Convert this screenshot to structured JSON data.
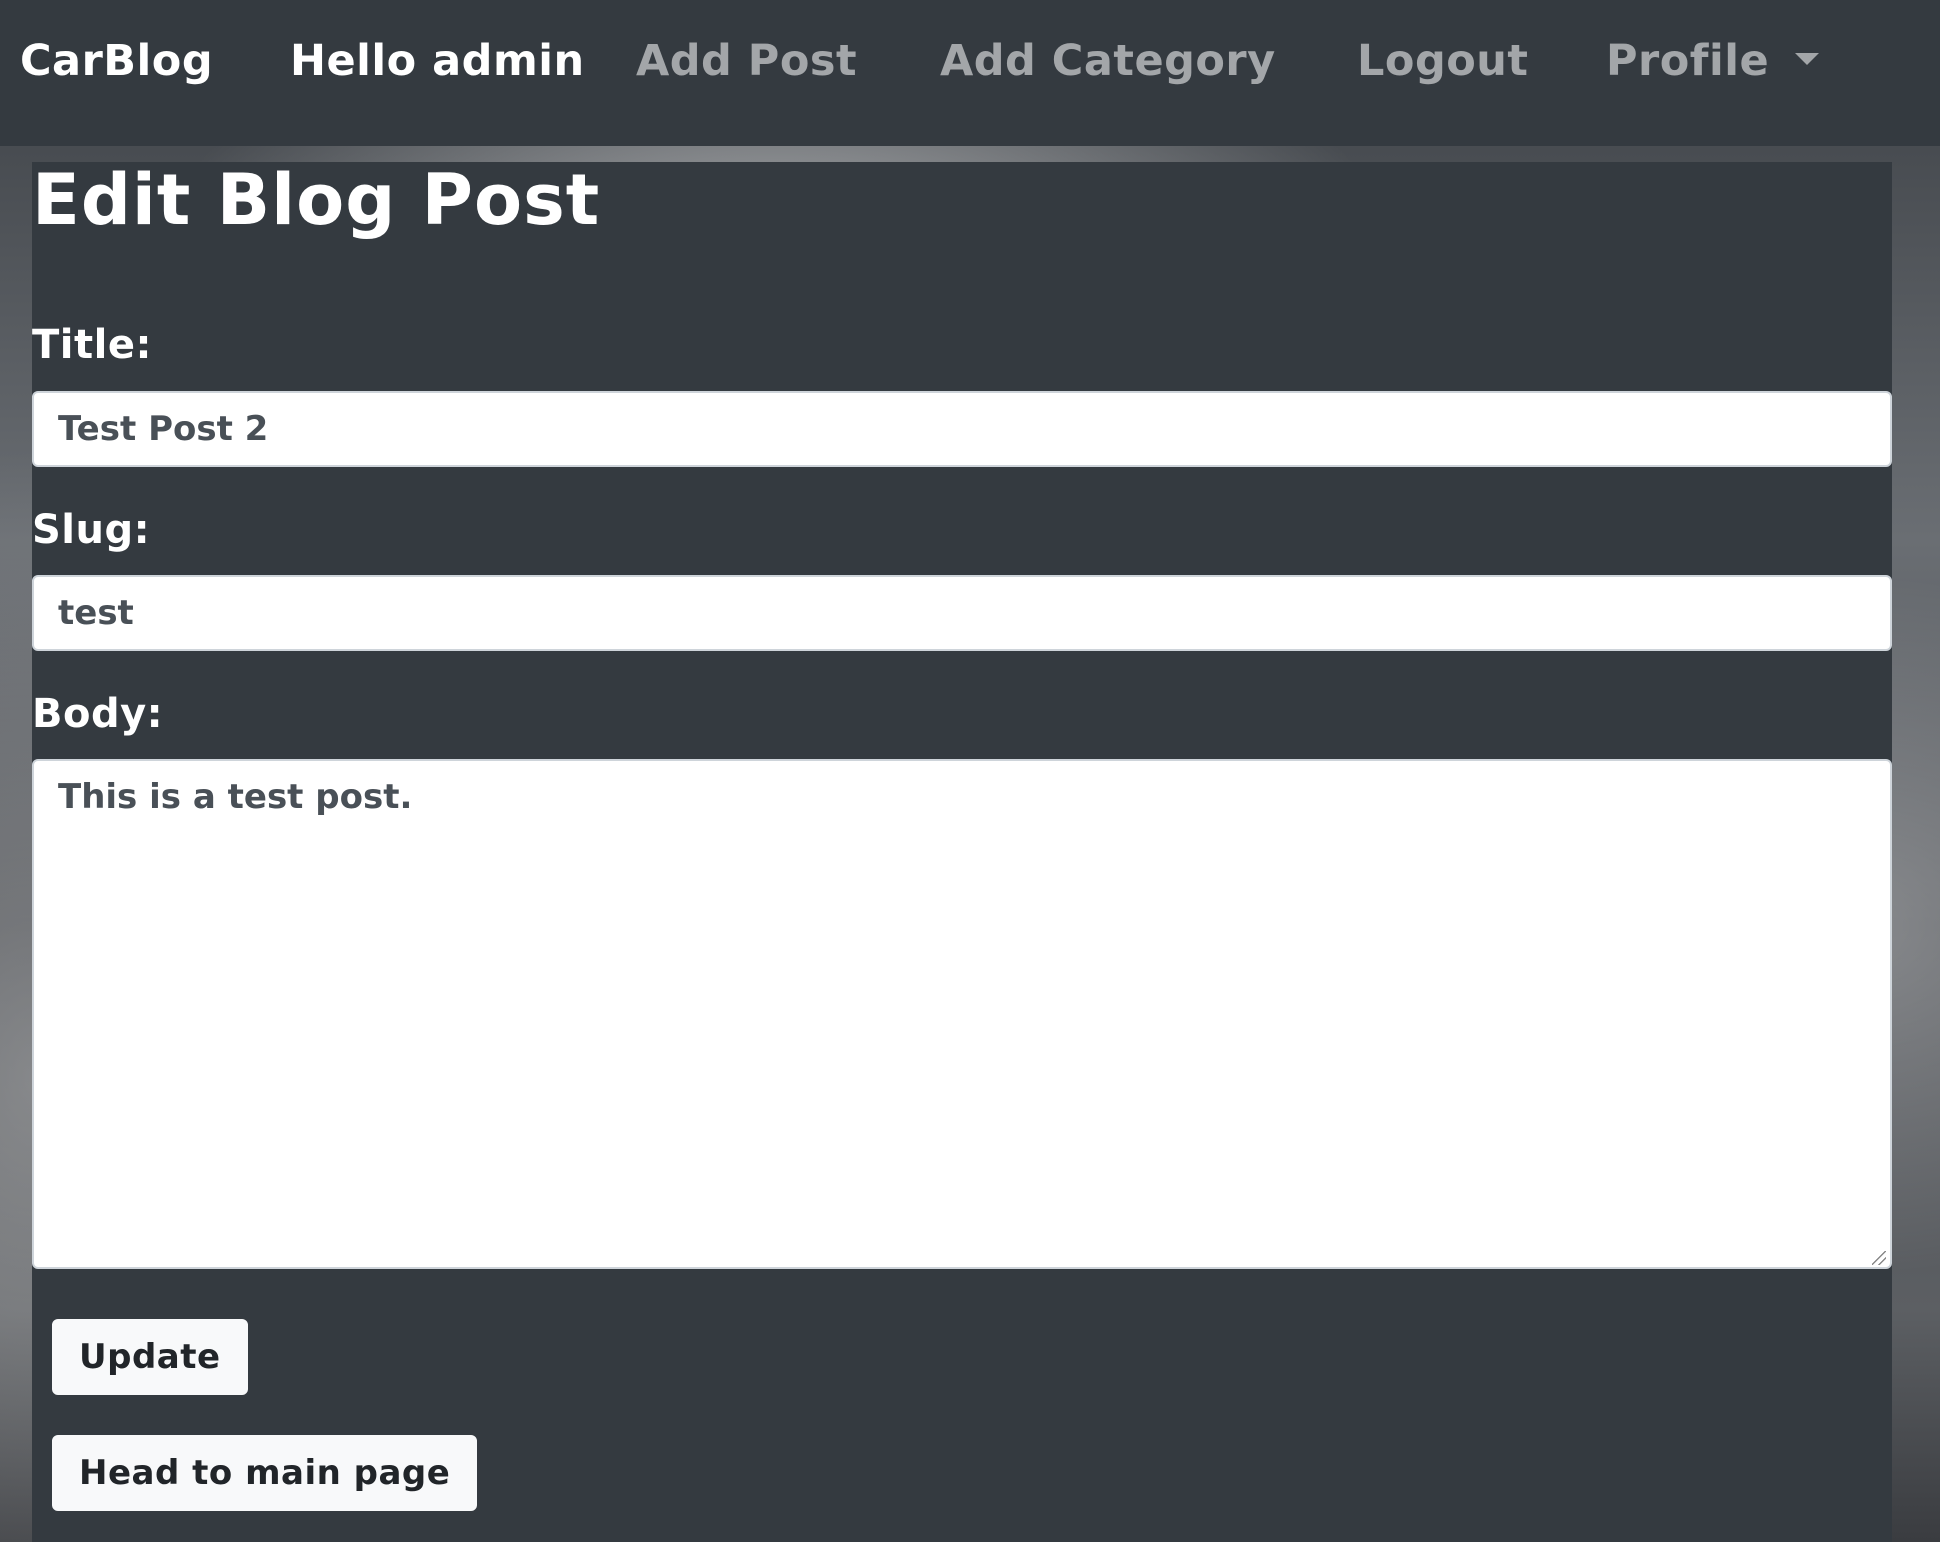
{
  "navbar": {
    "brand": "CarBlog",
    "greeting": "Hello admin",
    "links": {
      "add_post": "Add Post",
      "add_category": "Add Category",
      "logout": "Logout",
      "profile": "Profile"
    }
  },
  "form": {
    "heading": "Edit Blog Post",
    "title_label": "Title:",
    "title_value": "Test Post 2",
    "slug_label": "Slug:",
    "slug_value": "test",
    "body_label": "Body:",
    "body_value": "This is a test post.",
    "update_label": "Update",
    "main_page_label": "Head to main page"
  },
  "colors": {
    "navbar_bg": "#343a40",
    "panel_bg": "#343a40",
    "button_bg": "#f8f9fa"
  }
}
